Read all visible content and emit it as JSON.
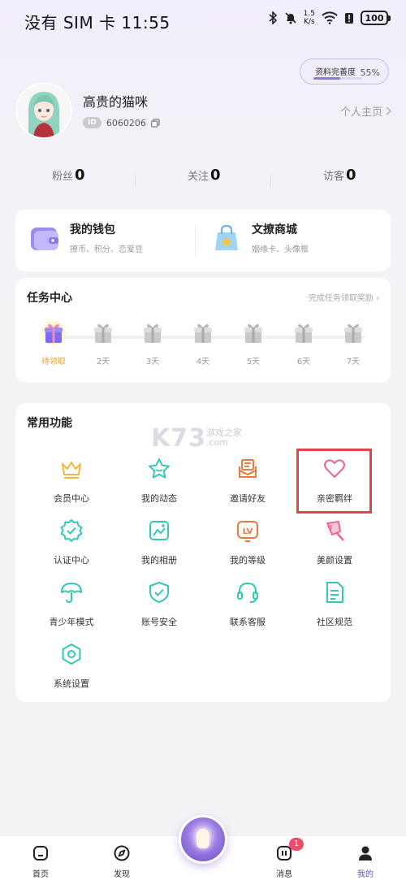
{
  "status_bar": {
    "left": "没有 SIM 卡 11:55",
    "speed_value": "1.5",
    "speed_unit": "K/s",
    "battery": "100"
  },
  "profile": {
    "completeness_label": "资料完善度",
    "completeness_value": "55%",
    "completeness_fraction": 0.55,
    "username": "高贵的猫咪",
    "id_badge": "ID",
    "id_value": "6060206",
    "homepage_link": "个人主页"
  },
  "stats": [
    {
      "label": "粉丝",
      "value": "0"
    },
    {
      "label": "关注",
      "value": "0"
    },
    {
      "label": "访客",
      "value": "0"
    }
  ],
  "wallet": {
    "items": [
      {
        "title": "我的钱包",
        "subtitle": "撩币、积分、恋爱豆",
        "icon": "wallet-icon"
      },
      {
        "title": "文撩商城",
        "subtitle": "姻缘卡、头像框",
        "icon": "shopping-bag-icon"
      }
    ]
  },
  "tasks": {
    "title": "任务中心",
    "link": "完成任务领取奖励",
    "days": [
      {
        "label": "待领取",
        "active": true
      },
      {
        "label": "2天",
        "active": false
      },
      {
        "label": "3天",
        "active": false
      },
      {
        "label": "4天",
        "active": false
      },
      {
        "label": "5天",
        "active": false
      },
      {
        "label": "6天",
        "active": false
      },
      {
        "label": "7天",
        "active": false
      }
    ]
  },
  "functions": {
    "title": "常用功能",
    "items": [
      {
        "label": "会员中心",
        "icon": "crown-icon",
        "color": "#f2b63d"
      },
      {
        "label": "我的动态",
        "icon": "star-icon",
        "color": "#35c7b5"
      },
      {
        "label": "邀请好友",
        "icon": "envelope-icon",
        "color": "#f0773a"
      },
      {
        "label": "亲密羁绊",
        "icon": "heart-icon",
        "color": "#f0668a"
      },
      {
        "label": "认证中心",
        "icon": "verified-badge-icon",
        "color": "#35c7b5"
      },
      {
        "label": "我的相册",
        "icon": "photo-icon",
        "color": "#35c7b5"
      },
      {
        "label": "我的等级",
        "icon": "level-icon",
        "color": "#f0773a"
      },
      {
        "label": "美颜设置",
        "icon": "beauty-icon",
        "color": "#f0668a"
      },
      {
        "label": "青少年模式",
        "icon": "umbrella-icon",
        "color": "#35c7b5"
      },
      {
        "label": "账号安全",
        "icon": "shield-check-icon",
        "color": "#35c7b5"
      },
      {
        "label": "联系客服",
        "icon": "headset-icon",
        "color": "#35c7b5"
      },
      {
        "label": "社区规范",
        "icon": "document-icon",
        "color": "#35c7b5"
      },
      {
        "label": "系统设置",
        "icon": "hexagon-settings-icon",
        "color": "#35c7b5"
      }
    ]
  },
  "watermark": {
    "brand": "K73",
    "sub_top": "游戏之家",
    "sub_bottom": ".com"
  },
  "bottom_nav": {
    "items": [
      {
        "label": "首页",
        "icon": "home-icon"
      },
      {
        "label": "发现",
        "icon": "compass-icon"
      },
      {
        "label": "消息",
        "icon": "message-icon",
        "badge": "1"
      },
      {
        "label": "我的",
        "icon": "profile-icon",
        "active": true
      }
    ]
  },
  "colors": {
    "accent": "#6b55c4",
    "highlight": "#e0434a",
    "teal": "#35c7b5",
    "orange": "#f0773a",
    "pink": "#f0668a",
    "gold": "#f2b63d"
  }
}
